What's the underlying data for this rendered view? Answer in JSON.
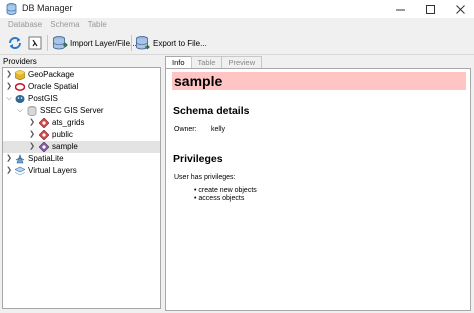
{
  "window": {
    "title": "DB Manager"
  },
  "menu": [
    "Database",
    "Schema",
    "Table"
  ],
  "toolbar": {
    "refresh_icon": "refresh-icon",
    "sql_icon": "sql-window-icon",
    "import_label": "Import Layer/File...",
    "export_label": "Export to File..."
  },
  "providers": {
    "header": "Providers",
    "items": [
      {
        "label": "GeoPackage",
        "icon": "geopackage-icon",
        "expanded": false
      },
      {
        "label": "Oracle Spatial",
        "icon": "oracle-icon",
        "expanded": false
      },
      {
        "label": "PostGIS",
        "icon": "postgis-icon",
        "expanded": true
      },
      {
        "label": "SSEC GIS Server",
        "icon": "server-icon",
        "expanded": true
      },
      {
        "label": "ats_grids",
        "icon": "schema-icon",
        "expanded": false
      },
      {
        "label": "public",
        "icon": "schema-icon",
        "expanded": false
      },
      {
        "label": "sample",
        "icon": "schema-icon",
        "expanded": false,
        "selected": true
      },
      {
        "label": "SpatiaLite",
        "icon": "spatialite-icon",
        "expanded": false
      },
      {
        "label": "Virtual Layers",
        "icon": "virtual-layers-icon",
        "expanded": false
      }
    ]
  },
  "tabs": [
    "Info",
    "Table",
    "Preview"
  ],
  "info": {
    "title": "sample",
    "schema_heading": "Schema details",
    "owner_label": "Owner:",
    "owner_value": "kelly",
    "privileges_heading": "Privileges",
    "privileges_line": "User has privileges:",
    "privileges": [
      "create new objects",
      "access objects"
    ]
  },
  "colors": {
    "banner": "#ffc4c4",
    "selection": "#e3e3e3"
  }
}
